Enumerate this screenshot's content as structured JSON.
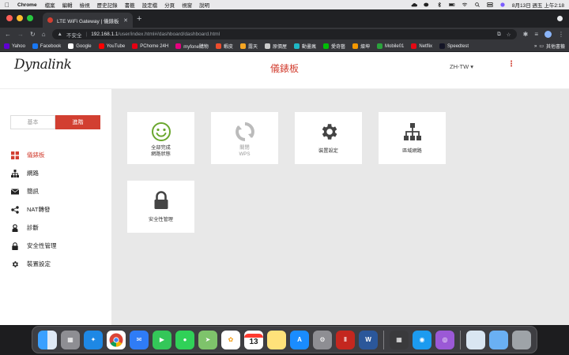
{
  "menubar": {
    "app_name": "Chrome",
    "menus": [
      "檔案",
      "編輯",
      "檢視",
      "歷史記錄",
      "書籤",
      "設定檔",
      "分頁",
      "視窗",
      "說明"
    ],
    "clock": "8月13日 週五 上午2:18"
  },
  "browser": {
    "tab_title": "LTE WiFi Gateway | 儀錶板",
    "security_label": "不安全",
    "url_host": "192.168.1.1",
    "url_path": "/user/index.html#/dashboard/dashboard.html",
    "bookmarks": [
      {
        "label": "Yahoo",
        "color": "#6001d2"
      },
      {
        "label": "Facebook",
        "color": "#1877f2"
      },
      {
        "label": "Google",
        "color": "#ffffff"
      },
      {
        "label": "YouTube",
        "color": "#ff0000"
      },
      {
        "label": "PChome 24H",
        "color": "#e60012"
      },
      {
        "label": "myfone購物",
        "color": "#e4007f"
      },
      {
        "label": "蝦皮",
        "color": "#ee4d2d"
      },
      {
        "label": "露天",
        "color": "#f5a623"
      },
      {
        "label": "原價屋",
        "color": "#cccccc"
      },
      {
        "label": "動畫瘋",
        "color": "#1eb8c5"
      },
      {
        "label": "愛奇藝",
        "color": "#00be06"
      },
      {
        "label": "燦坤",
        "color": "#f39800"
      },
      {
        "label": "Mobile01",
        "color": "#2aa33c"
      },
      {
        "label": "Netflix",
        "color": "#e50914"
      },
      {
        "label": "Speedtest",
        "color": "#141526"
      }
    ],
    "other_bookmarks": "其他書籤"
  },
  "page": {
    "brand": "Dynalink",
    "title": "儀錶板",
    "language": "ZH-TW",
    "mode_basic": "基本",
    "mode_advanced": "進階",
    "nav": [
      {
        "label": "儀錶板",
        "icon": "dashboard-icon",
        "active": true
      },
      {
        "label": "網路",
        "icon": "network-icon",
        "active": false
      },
      {
        "label": "簡訊",
        "icon": "sms-icon",
        "active": false
      },
      {
        "label": "NAT轉發",
        "icon": "share-icon",
        "active": false
      },
      {
        "label": "診斷",
        "icon": "diagnostics-icon",
        "active": false
      },
      {
        "label": "安全性管理",
        "icon": "lock-icon",
        "active": false
      },
      {
        "label": "裝置設定",
        "icon": "gear-icon",
        "active": false
      }
    ],
    "cards": [
      {
        "line1": "全部完成",
        "line2": "網路狀態",
        "icon": "smiley-icon",
        "color": "#6aa72e"
      },
      {
        "line1": "關閉",
        "line2": "WPS",
        "icon": "wps-icon",
        "color": "#bbbbbb"
      },
      {
        "line1": "裝置設定",
        "line2": "",
        "icon": "gear-icon",
        "color": "#444444"
      },
      {
        "line1": "區域網路",
        "line2": "",
        "icon": "lan-icon",
        "color": "#444444"
      },
      {
        "line1": "安全性管理",
        "line2": "",
        "icon": "lock-icon",
        "color": "#444444"
      }
    ]
  },
  "dock": {
    "calendar_day": "13",
    "apps": [
      "finder",
      "launchpad",
      "safari",
      "chrome",
      "mail",
      "facetime",
      "messages",
      "maps",
      "photos",
      "calendar",
      "notes",
      "app-store",
      "system-preferences",
      "parallels",
      "word",
      "calculator",
      "network-utility",
      "podcasts",
      "preview",
      "folder",
      "trash"
    ]
  },
  "colors": {
    "accent": "#d23f31",
    "main_bg": "#e8e8e8"
  }
}
